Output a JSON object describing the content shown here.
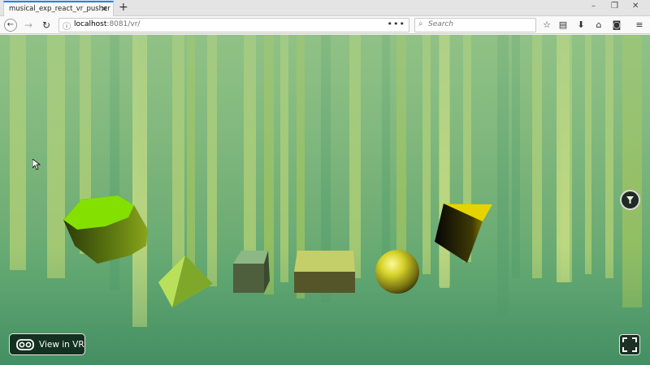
{
  "browser": {
    "tab_title": "musical_exp_react_vr_pusher",
    "tab_close": "×",
    "new_tab": "+",
    "window_controls": [
      "–",
      "❐",
      "✕"
    ],
    "url_host": "localhost",
    "url_rest": ":8081/vr/",
    "page_actions": "•••",
    "search_placeholder": "Search",
    "toolbar_icons": [
      "star-icon",
      "reading-list-icon",
      "download-icon",
      "home-icon",
      "pocket-icon",
      "menu-icon"
    ]
  },
  "vr": {
    "view_in_vr_label": "View in VR"
  },
  "scene": {
    "background_top": "#6dab6e",
    "background_bottom": "#4c9a6c",
    "shapes": [
      "cylinder",
      "pyramid",
      "cube",
      "box",
      "sphere",
      "tilted-cube"
    ],
    "accent_green": "#84e000",
    "accent_yellow": "#e5d400"
  }
}
